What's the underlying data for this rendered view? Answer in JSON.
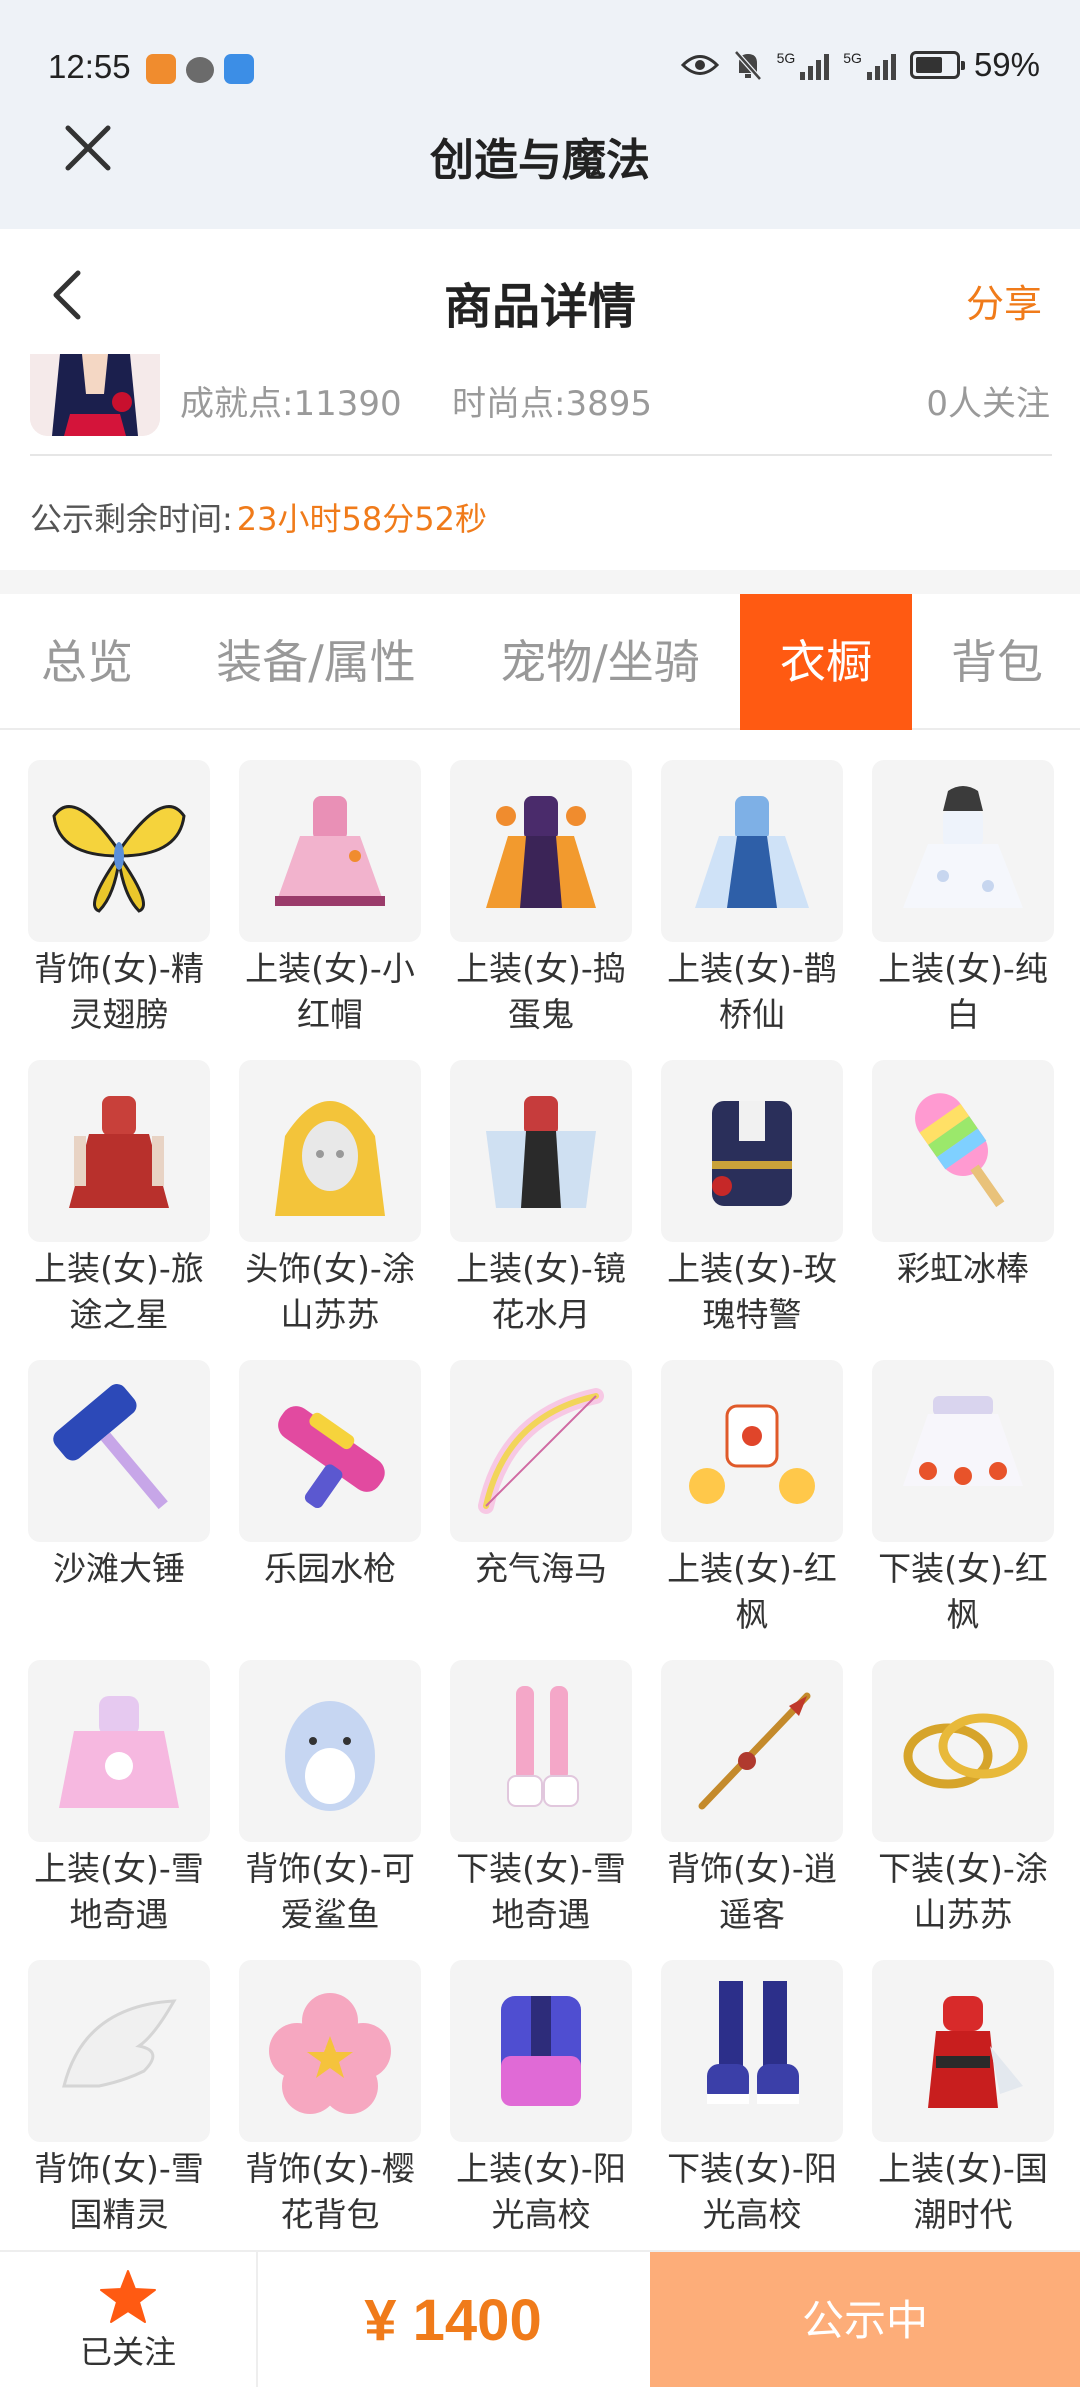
{
  "status_bar": {
    "time": "12:55",
    "battery": "59%",
    "sig1": "5G",
    "sig2": "5G"
  },
  "app": {
    "title": "创造与魔法"
  },
  "header": {
    "title": "商品详情",
    "share": "分享"
  },
  "profile": {
    "achievement": "成就点:11390",
    "fashion": "时尚点:3895",
    "followers": "0人关注"
  },
  "remaining": {
    "label": "公示剩余时间:",
    "value": "23小时58分52秒"
  },
  "tabs": [
    {
      "label": "总览"
    },
    {
      "label": "装备/属性"
    },
    {
      "label": "宠物/坐骑"
    },
    {
      "label": "衣橱"
    },
    {
      "label": "背包"
    }
  ],
  "active_tab": "衣橱",
  "items": [
    {
      "name": "背饰(女)-精灵翅膀",
      "icon": "butterfly-wings-icon"
    },
    {
      "name": "上装(女)-小红帽",
      "icon": "pink-dress-icon"
    },
    {
      "name": "上装(女)-捣蛋鬼",
      "icon": "halloween-dress-icon"
    },
    {
      "name": "上装(女)-鹊桥仙",
      "icon": "blue-gown-icon"
    },
    {
      "name": "上装(女)-纯白",
      "icon": "white-dress-icon"
    },
    {
      "name": "上装(女)-旅途之星",
      "icon": "red-dress-icon"
    },
    {
      "name": "头饰(女)-涂山苏苏",
      "icon": "blonde-wig-icon"
    },
    {
      "name": "上装(女)-镜花水月",
      "icon": "kimono-dress-icon"
    },
    {
      "name": "上装(女)-玫瑰特警",
      "icon": "uniform-icon"
    },
    {
      "name": "彩虹冰棒",
      "icon": "rainbow-popsicle-icon"
    },
    {
      "name": "沙滩大锤",
      "icon": "hammer-icon"
    },
    {
      "name": "乐园水枪",
      "icon": "water-gun-icon"
    },
    {
      "name": "充气海马",
      "icon": "inflatable-bow-icon"
    },
    {
      "name": "上装(女)-红枫",
      "icon": "maple-top-icon"
    },
    {
      "name": "下装(女)-红枫",
      "icon": "maple-skirt-icon"
    },
    {
      "name": "上装(女)-雪地奇遇",
      "icon": "snow-dress-icon"
    },
    {
      "name": "背饰(女)-可爱鲨鱼",
      "icon": "shark-backpack-icon"
    },
    {
      "name": "下装(女)-雪地奇遇",
      "icon": "snow-boots-icon"
    },
    {
      "name": "背饰(女)-逍遥客",
      "icon": "spear-icon"
    },
    {
      "name": "下装(女)-涂山苏苏",
      "icon": "gold-rings-icon"
    },
    {
      "name": "背饰(女)-雪国精灵",
      "icon": "white-wings-icon"
    },
    {
      "name": "背饰(女)-樱花背包",
      "icon": "sakura-backpack-icon"
    },
    {
      "name": "上装(女)-阳光高校",
      "icon": "jacket-icon"
    },
    {
      "name": "下装(女)-阳光高校",
      "icon": "sneakers-icon"
    },
    {
      "name": "上装(女)-国潮时代",
      "icon": "qipao-icon"
    }
  ],
  "bottom": {
    "follow": "已关注",
    "price": "¥ 1400",
    "status": "公示中"
  },
  "colors": {
    "accent": "#ff5a12",
    "orange_text": "#f07b1a",
    "status_button": "#fdad79"
  }
}
